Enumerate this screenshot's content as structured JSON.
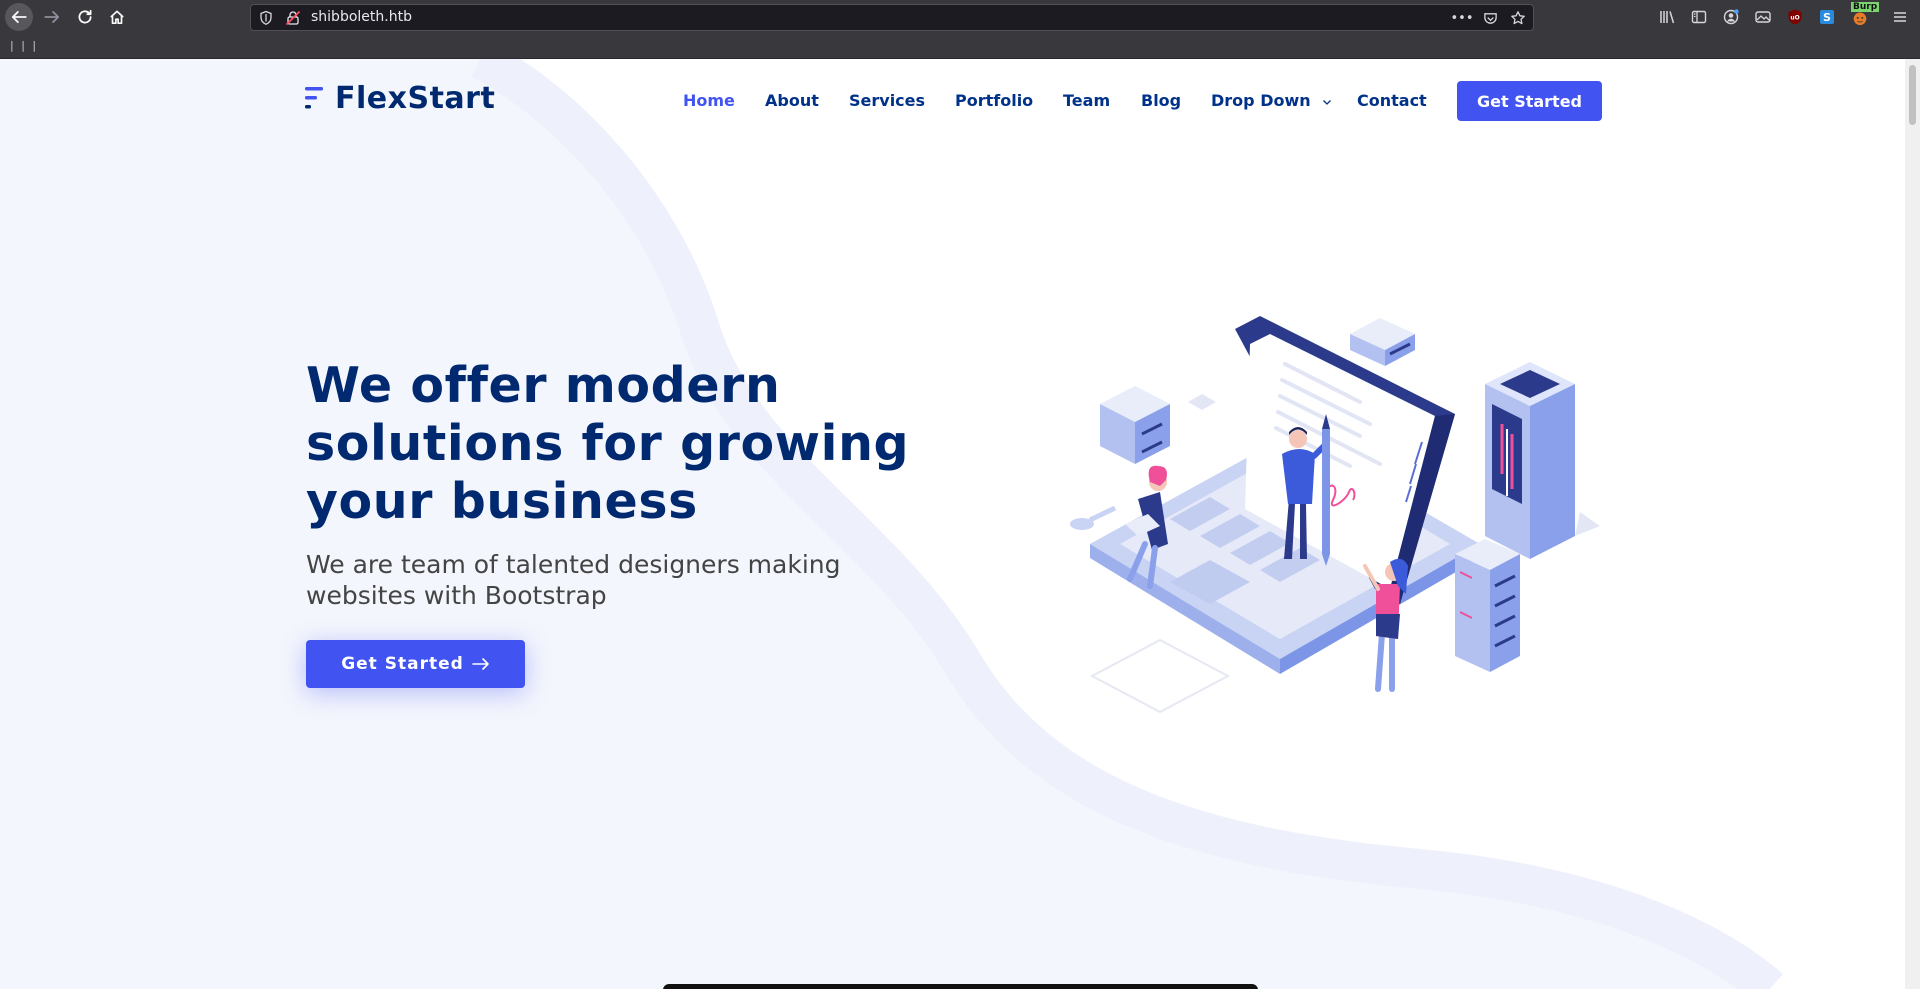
{
  "browser": {
    "url": "shibboleth.htb",
    "bookmarks_text": "| | |",
    "page_actions": [
      "more-icon",
      "pocket-icon",
      "bookmark-star-icon"
    ],
    "extensions": [
      "library-icon",
      "sidebar-icon",
      "account-icon",
      "screenshot-icon",
      "ublock-icon",
      "stylus-icon",
      "burp-icon",
      "menu-icon"
    ],
    "burp_label": "Burp"
  },
  "site": {
    "logo_text": "FlexStart",
    "nav": {
      "items": [
        {
          "label": "Home",
          "active": true
        },
        {
          "label": "About"
        },
        {
          "label": "Services"
        },
        {
          "label": "Portfolio"
        },
        {
          "label": "Team"
        },
        {
          "label": "Blog"
        },
        {
          "label": "Drop Down"
        },
        {
          "label": "Contact"
        }
      ],
      "cta_label": "Get Started"
    },
    "hero": {
      "title_lines": [
        "We offer modern",
        "solutions for growing",
        "your business"
      ],
      "subtitle_lines": [
        "We are team of talented designers making",
        "websites with Bootstrap"
      ],
      "button_label": "Get Started"
    }
  },
  "colors": {
    "primary": "#4154f1",
    "heading": "#012970",
    "nav_text": "#013289",
    "page_bg": "#f4f6fd",
    "text": "#444444"
  }
}
